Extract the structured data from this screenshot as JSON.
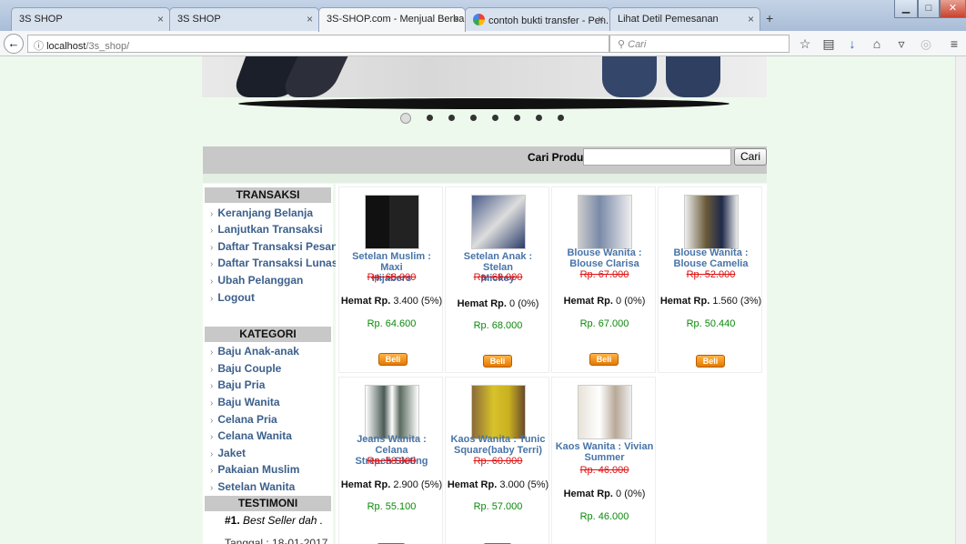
{
  "tabs": [
    {
      "title": "3S SHOP"
    },
    {
      "title": "3S SHOP"
    },
    {
      "title": "3S-SHOP.com - Menjual Berba..."
    },
    {
      "title": "contoh bukti transfer - Pen..."
    },
    {
      "title": "Lihat Detil Pemesanan"
    }
  ],
  "toolbar": {
    "url_host": "localhost",
    "url_path": "/3s_shop/",
    "search_placeholder": "Cari"
  },
  "search": {
    "label": "Cari Produk",
    "button": "Cari"
  },
  "sidebar": {
    "transaksi_title": "TRANSAKSI",
    "transaksi": [
      "Keranjang Belanja",
      "Lanjutkan Transaksi",
      "Daftar Transaksi Pesan",
      "Daftar Transaksi Lunas",
      "Ubah Pelanggan",
      "Logout"
    ],
    "kategori_title": "KATEGORI",
    "kategori": [
      "Baju Anak-anak",
      "Baju Couple",
      "Baju Pria",
      "Baju Wanita",
      "Celana Pria",
      "Celana Wanita",
      "Jaket",
      "Pakaian Muslim",
      "Setelan Wanita"
    ],
    "testimoni_title": "TESTIMONI",
    "testimoni_num": "#1.",
    "testimoni_text": "Best Seller dah .",
    "testimoni_date": "Tanggal : 18-01-2017"
  },
  "products": [
    {
      "name_1": "Setelan Muslim : Maxi",
      "name_2": "Hijabers",
      "old": "Rp. 68.000",
      "hemat_label": "Hemat Rp.",
      "hemat": "3.400 (5%)",
      "price": "Rp. 64.600",
      "buy": "Beli"
    },
    {
      "name_1": "Setelan Anak : Stelan",
      "name_2": "Mickey",
      "old": "Rp. 68.000",
      "hemat_label": "Hemat Rp.",
      "hemat": "0 (0%)",
      "price": "Rp. 68.000",
      "buy": "Beli"
    },
    {
      "name_1": "Blouse Wanita :",
      "name_2": "Blouse Clarisa",
      "old": "Rp. 67.000",
      "hemat_label": "Hemat Rp.",
      "hemat": "0 (0%)",
      "price": "Rp. 67.000",
      "buy": "Beli"
    },
    {
      "name_1": "Blouse Wanita :",
      "name_2": "Blouse Camelia",
      "old": "Rp. 52.000",
      "hemat_label": "Hemat Rp.",
      "hemat": "1.560 (3%)",
      "price": "Rp. 50.440",
      "buy": "Beli"
    },
    {
      "name_1": "Jeans Wanita : Celana",
      "name_2": "Streach Sleting",
      "old": "Rp. 58.000",
      "hemat_label": "Hemat Rp.",
      "hemat": "2.900 (5%)",
      "price": "Rp. 55.100",
      "buy": ""
    },
    {
      "name_1": "Kaos Wanita : Tunic",
      "name_2": "Square(baby Terri)",
      "old": "Rp. 60.000",
      "hemat_label": "Hemat Rp.",
      "hemat": "3.000 (5%)",
      "price": "Rp. 57.000",
      "buy": ""
    },
    {
      "name_1": "Kaos Wanita : Vivian",
      "name_2": "Summer",
      "old": "Rp. 46.000",
      "hemat_label": "Hemat Rp.",
      "hemat": "0 (0%)",
      "price": "Rp. 46.000",
      "buy": ""
    }
  ],
  "colors": {
    "page_bg": "#eef9ee",
    "link": "#3c5f8c",
    "price": "#0a8a0a",
    "old_price": "#d11111",
    "buy_button": "#f28c0f"
  }
}
